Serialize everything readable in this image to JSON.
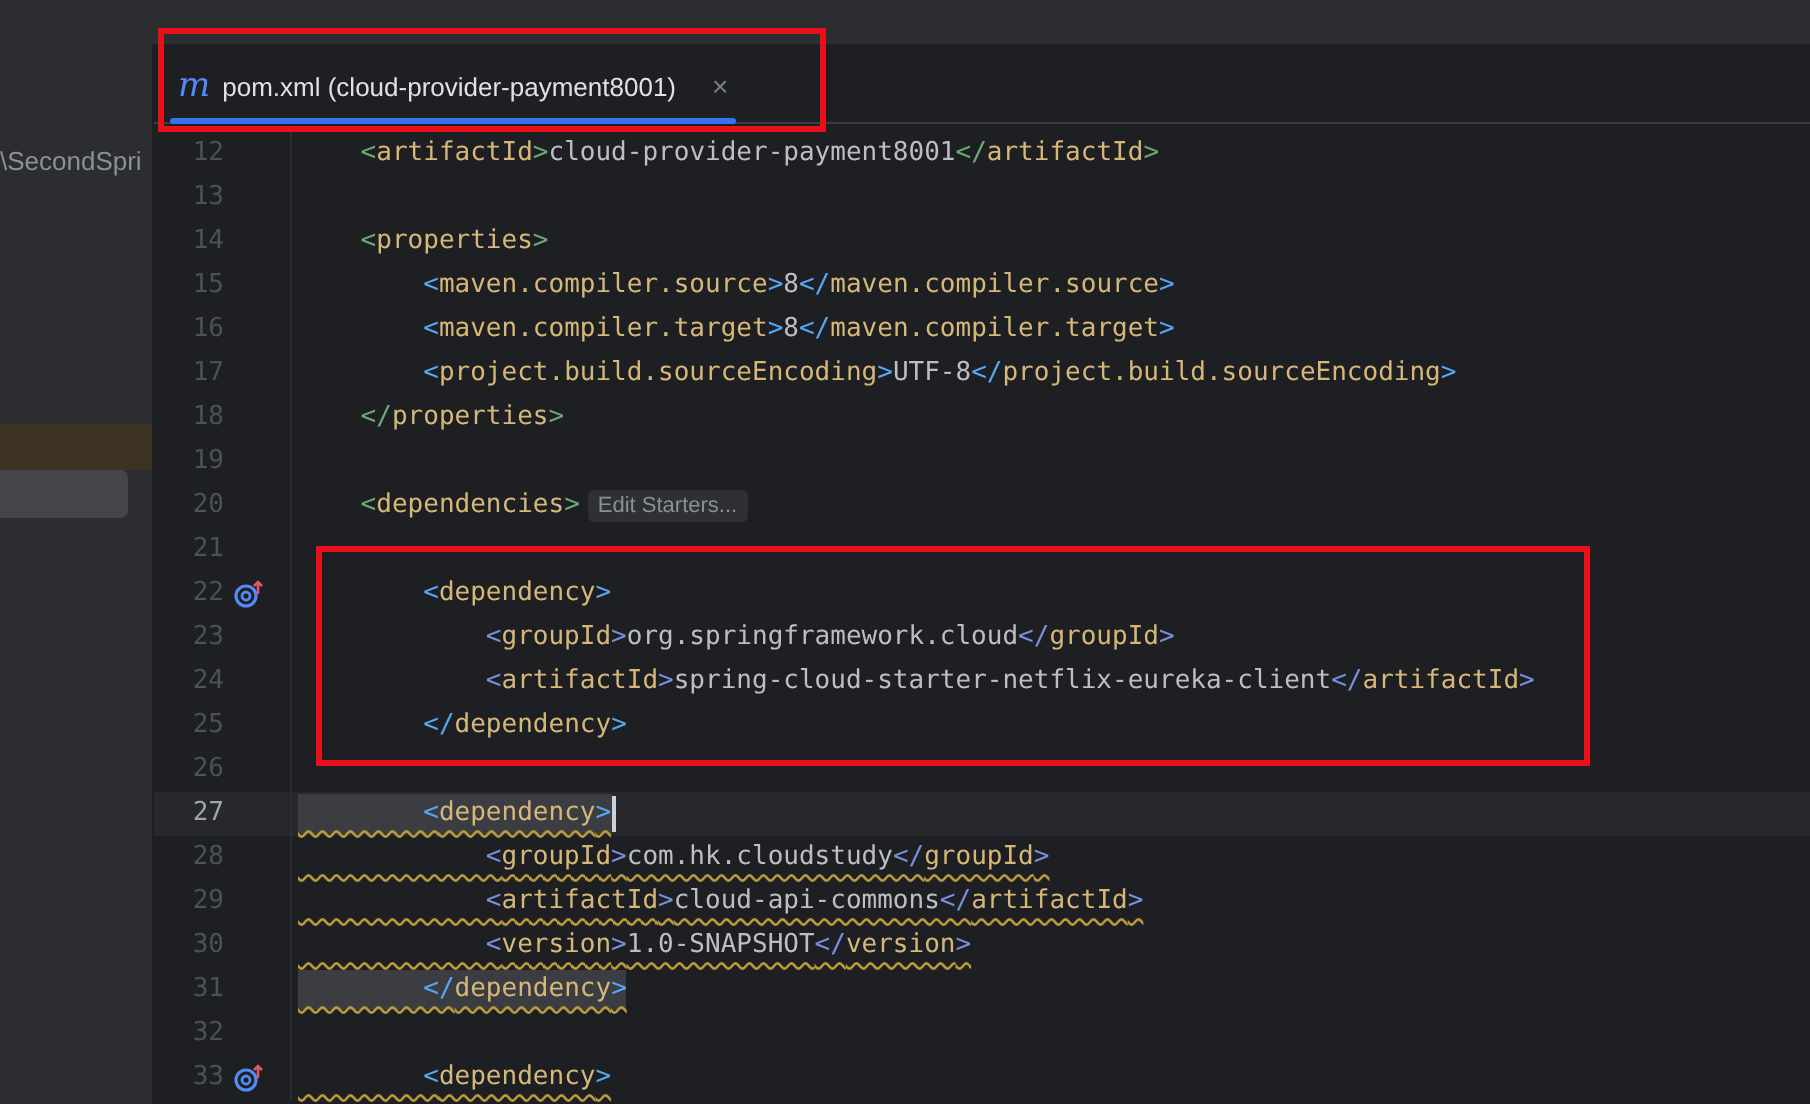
{
  "sidebar": {
    "path_text": "\\SecondSpri"
  },
  "tabs": [
    {
      "icon": "m",
      "label": "pom.xml (cloud-provider-payment8001)",
      "close": "×",
      "selected": true
    }
  ],
  "editor": {
    "lines": [
      {
        "number": "12",
        "current": false,
        "warning": false,
        "matched": false,
        "gutter_icon": false,
        "tokens": [
          {
            "kind": "bracket",
            "text": "    <",
            "color": "#6aab73"
          },
          {
            "kind": "tag",
            "text": "artifactId"
          },
          {
            "kind": "bracket",
            "text": ">",
            "color": "#6aab73"
          },
          {
            "kind": "value",
            "text": "cloud-provider-payment8001"
          },
          {
            "kind": "bracket",
            "text": "</",
            "color": "#6aab73"
          },
          {
            "kind": "tag",
            "text": "artifactId"
          },
          {
            "kind": "bracket",
            "text": ">",
            "color": "#6aab73"
          }
        ]
      },
      {
        "number": "13",
        "current": false,
        "gutter_icon": false
      },
      {
        "number": "14",
        "current": false,
        "warning": false,
        "matched": false,
        "gutter_icon": false,
        "tokens": [
          {
            "kind": "bracket",
            "text": "    <",
            "color": "#6aab73"
          },
          {
            "kind": "tag",
            "text": "properties"
          },
          {
            "kind": "bracket",
            "text": ">",
            "color": "#6aab73"
          }
        ]
      },
      {
        "number": "15",
        "current": false,
        "warning": false,
        "matched": false,
        "gutter_icon": false,
        "tokens": [
          {
            "kind": "bracket",
            "text": "        <",
            "color": "#56a8f5"
          },
          {
            "kind": "tag",
            "text": "maven.compiler.source"
          },
          {
            "kind": "bracket",
            "text": ">",
            "color": "#56a8f5"
          },
          {
            "kind": "value",
            "text": "8"
          },
          {
            "kind": "bracket",
            "text": "</",
            "color": "#56a8f5"
          },
          {
            "kind": "tag",
            "text": "maven.compiler.source"
          },
          {
            "kind": "bracket",
            "text": ">",
            "color": "#56a8f5"
          }
        ]
      },
      {
        "number": "16",
        "current": false,
        "warning": false,
        "matched": false,
        "gutter_icon": false,
        "tokens": [
          {
            "kind": "bracket",
            "text": "        <",
            "color": "#56a8f5"
          },
          {
            "kind": "tag",
            "text": "maven.compiler.target"
          },
          {
            "kind": "bracket",
            "text": ">",
            "color": "#56a8f5"
          },
          {
            "kind": "value",
            "text": "8"
          },
          {
            "kind": "bracket",
            "text": "</",
            "color": "#56a8f5"
          },
          {
            "kind": "tag",
            "text": "maven.compiler.target"
          },
          {
            "kind": "bracket",
            "text": ">",
            "color": "#56a8f5"
          }
        ]
      },
      {
        "number": "17",
        "current": false,
        "warning": false,
        "matched": false,
        "gutter_icon": false,
        "tokens": [
          {
            "kind": "bracket",
            "text": "        <",
            "color": "#56a8f5"
          },
          {
            "kind": "tag",
            "text": "project.build.sourceEncoding"
          },
          {
            "kind": "bracket",
            "text": ">",
            "color": "#56a8f5"
          },
          {
            "kind": "value",
            "text": "UTF-8"
          },
          {
            "kind": "bracket",
            "text": "</",
            "color": "#56a8f5"
          },
          {
            "kind": "tag",
            "text": "project.build.sourceEncoding"
          },
          {
            "kind": "bracket",
            "text": ">",
            "color": "#56a8f5"
          }
        ]
      },
      {
        "number": "18",
        "current": false,
        "warning": false,
        "matched": false,
        "gutter_icon": false,
        "tokens": [
          {
            "kind": "bracket",
            "text": "    </",
            "color": "#6aab73"
          },
          {
            "kind": "tag",
            "text": "properties"
          },
          {
            "kind": "bracket",
            "text": ">",
            "color": "#6aab73"
          }
        ]
      },
      {
        "number": "19",
        "current": false,
        "gutter_icon": false
      },
      {
        "number": "20",
        "current": false,
        "warning": false,
        "matched": false,
        "gutter_icon": false,
        "tokens": [
          {
            "kind": "bracket",
            "text": "    <",
            "color": "#6aab73"
          },
          {
            "kind": "tag",
            "text": "dependencies"
          },
          {
            "kind": "bracket",
            "text": ">",
            "color": "#6aab73"
          },
          {
            "kind": "hint",
            "text": "Edit Starters..."
          }
        ]
      },
      {
        "number": "21",
        "current": false,
        "gutter_icon": false
      },
      {
        "number": "22",
        "current": false,
        "warning": false,
        "matched": false,
        "gutter_icon": true,
        "tokens": [
          {
            "kind": "bracket",
            "text": "        <",
            "color": "#56a8f5"
          },
          {
            "kind": "tag",
            "text": "dependency"
          },
          {
            "kind": "bracket",
            "text": ">",
            "color": "#56a8f5"
          }
        ]
      },
      {
        "number": "23",
        "current": false,
        "warning": false,
        "matched": false,
        "gutter_icon": false,
        "tokens": [
          {
            "kind": "bracket",
            "text": "            <",
            "color": "#7a8fe0"
          },
          {
            "kind": "tag",
            "text": "groupId"
          },
          {
            "kind": "bracket",
            "text": ">",
            "color": "#7a8fe0"
          },
          {
            "kind": "value",
            "text": "org.springframework.cloud"
          },
          {
            "kind": "bracket",
            "text": "</",
            "color": "#7a8fe0"
          },
          {
            "kind": "tag",
            "text": "groupId"
          },
          {
            "kind": "bracket",
            "text": ">",
            "color": "#7a8fe0"
          }
        ]
      },
      {
        "number": "24",
        "current": false,
        "warning": false,
        "matched": false,
        "gutter_icon": false,
        "tokens": [
          {
            "kind": "bracket",
            "text": "            <",
            "color": "#7a8fe0"
          },
          {
            "kind": "tag",
            "text": "artifactId"
          },
          {
            "kind": "bracket",
            "text": ">",
            "color": "#7a8fe0"
          },
          {
            "kind": "value",
            "text": "spring-cloud-starter-netflix-eureka-client"
          },
          {
            "kind": "bracket",
            "text": "</",
            "color": "#7a8fe0"
          },
          {
            "kind": "tag",
            "text": "artifactId"
          },
          {
            "kind": "bracket",
            "text": ">",
            "color": "#7a8fe0"
          }
        ]
      },
      {
        "number": "25",
        "current": false,
        "warning": false,
        "matched": false,
        "gutter_icon": false,
        "tokens": [
          {
            "kind": "bracket",
            "text": "        </",
            "color": "#56a8f5"
          },
          {
            "kind": "tag",
            "text": "dependency"
          },
          {
            "kind": "bracket",
            "text": ">",
            "color": "#56a8f5"
          }
        ]
      },
      {
        "number": "26",
        "current": false,
        "gutter_icon": false
      },
      {
        "number": "27",
        "current": true,
        "warning": true,
        "matched": true,
        "gutter_icon": false,
        "tokens": [
          {
            "kind": "bracket",
            "text": "        <",
            "color": "#56a8f5"
          },
          {
            "kind": "tag",
            "text": "dependency"
          },
          {
            "kind": "bracket",
            "text": ">",
            "color": "#56a8f5"
          }
        ]
      },
      {
        "number": "28",
        "current": false,
        "warning": true,
        "matched": false,
        "gutter_icon": false,
        "tokens": [
          {
            "kind": "bracket",
            "text": "            <",
            "color": "#7a8fe0"
          },
          {
            "kind": "tag",
            "text": "groupId"
          },
          {
            "kind": "bracket",
            "text": ">",
            "color": "#7a8fe0"
          },
          {
            "kind": "value",
            "text": "com.hk.cloudstudy"
          },
          {
            "kind": "bracket",
            "text": "</",
            "color": "#7a8fe0"
          },
          {
            "kind": "tag",
            "text": "groupId"
          },
          {
            "kind": "bracket",
            "text": ">",
            "color": "#7a8fe0"
          }
        ]
      },
      {
        "number": "29",
        "current": false,
        "warning": true,
        "matched": false,
        "gutter_icon": false,
        "tokens": [
          {
            "kind": "bracket",
            "text": "            <",
            "color": "#7a8fe0"
          },
          {
            "kind": "tag",
            "text": "artifactId"
          },
          {
            "kind": "bracket",
            "text": ">",
            "color": "#7a8fe0"
          },
          {
            "kind": "value",
            "text": "cloud-api-commons"
          },
          {
            "kind": "bracket",
            "text": "</",
            "color": "#7a8fe0"
          },
          {
            "kind": "tag",
            "text": "artifactId"
          },
          {
            "kind": "bracket",
            "text": ">",
            "color": "#7a8fe0"
          }
        ]
      },
      {
        "number": "30",
        "current": false,
        "warning": true,
        "matched": false,
        "gutter_icon": false,
        "tokens": [
          {
            "kind": "bracket",
            "text": "            <",
            "color": "#7a8fe0"
          },
          {
            "kind": "tag",
            "text": "version"
          },
          {
            "kind": "bracket",
            "text": ">",
            "color": "#7a8fe0"
          },
          {
            "kind": "value",
            "text": "1.0-SNAPSHOT"
          },
          {
            "kind": "bracket",
            "text": "</",
            "color": "#7a8fe0"
          },
          {
            "kind": "tag",
            "text": "version"
          },
          {
            "kind": "bracket",
            "text": ">",
            "color": "#7a8fe0"
          }
        ]
      },
      {
        "number": "31",
        "current": false,
        "warning": true,
        "matched": true,
        "gutter_icon": false,
        "tokens": [
          {
            "kind": "bracket",
            "text": "        </",
            "color": "#56a8f5"
          },
          {
            "kind": "tag",
            "text": "dependency"
          },
          {
            "kind": "bracket",
            "text": ">",
            "color": "#56a8f5"
          }
        ]
      },
      {
        "number": "32",
        "current": false,
        "gutter_icon": false
      },
      {
        "number": "33",
        "current": false,
        "warning": true,
        "matched": false,
        "gutter_icon": true,
        "tokens": [
          {
            "kind": "bracket",
            "text": "        <",
            "color": "#56a8f5"
          },
          {
            "kind": "tag",
            "text": "dependency"
          },
          {
            "kind": "bracket",
            "text": ">",
            "color": "#56a8f5"
          }
        ]
      }
    ]
  }
}
